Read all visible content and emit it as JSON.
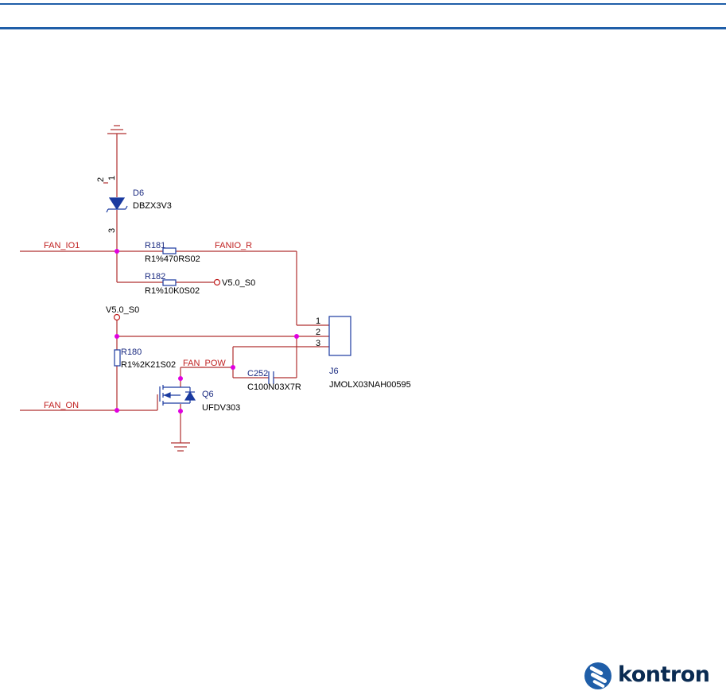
{
  "colors": {
    "wire": "#b03030",
    "junction": "#e000e0",
    "component": "#1a3aa0",
    "designator": "#1a2a80",
    "net_label": "#c02020",
    "value_text": "#000000",
    "brand": "#1f5ea8"
  },
  "net_labels": {
    "fan_io1": "FAN_IO1",
    "fanio_r": "FANIO_R",
    "fan_on": "FAN_ON",
    "fan_pow": "FAN_POW"
  },
  "power_labels": {
    "v50_s0_top": "V5.0_S0",
    "v50_s0_right": "V5.0_S0"
  },
  "components": {
    "d6": {
      "designator": "D6",
      "value": "DBZX3V3",
      "pin1": "1",
      "pin2": "2",
      "pin3": "3"
    },
    "r181": {
      "designator": "R181",
      "value": "R1%470RS02"
    },
    "r182": {
      "designator": "R182",
      "value": "R1%10K0S02"
    },
    "r180": {
      "designator": "R180",
      "value": "R1%2K21S02"
    },
    "c252": {
      "designator": "C252",
      "value": "C100N03X7R"
    },
    "q6": {
      "designator": "Q6",
      "value": "UFDV303"
    },
    "j6": {
      "designator": "J6",
      "value": "JMOLX03NAH00595",
      "pin1": "1",
      "pin2": "2",
      "pin3": "3"
    }
  },
  "logo": {
    "text": "kontron",
    "icon": "kontron-logo-icon"
  }
}
